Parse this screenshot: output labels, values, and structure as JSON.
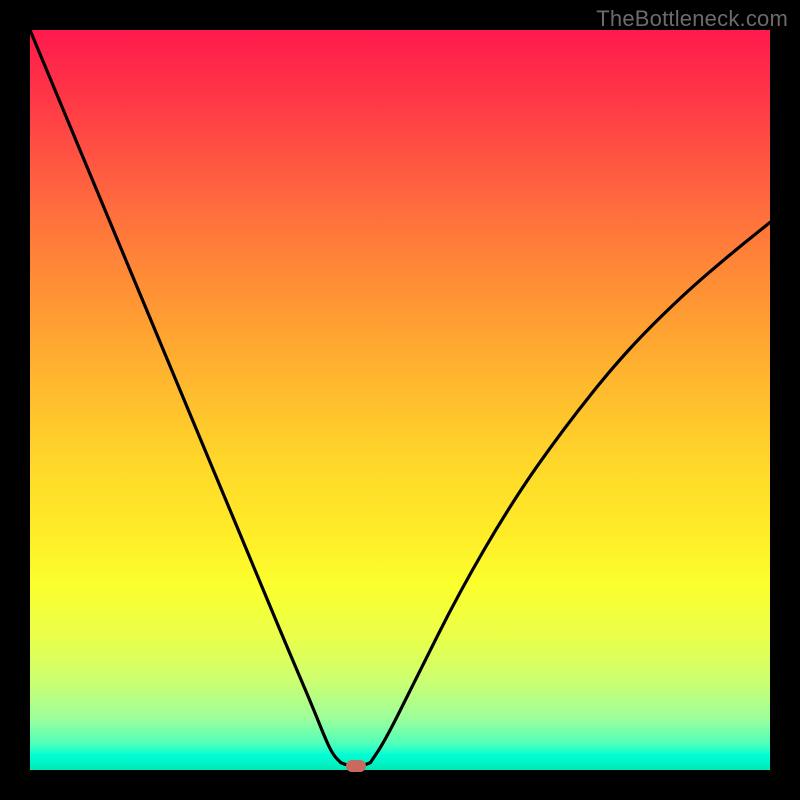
{
  "watermark": "TheBottleneck.com",
  "colors": {
    "frame": "#000000",
    "curve": "#000000",
    "marker": "#c96a5e",
    "gradient_top": "#ff1a4d",
    "gradient_bottom": "#00e8b6"
  },
  "chart_data": {
    "type": "line",
    "title": "",
    "xlabel": "",
    "ylabel": "",
    "xlim": [
      0,
      100
    ],
    "ylim": [
      0,
      100
    ],
    "grid": false,
    "legend": false,
    "series": [
      {
        "name": "left-branch",
        "x": [
          0,
          5,
          10,
          15,
          20,
          25,
          30,
          35,
          38,
          40,
          41,
          42
        ],
        "y": [
          100,
          88,
          76,
          64,
          52,
          40,
          28,
          16,
          9,
          4,
          2,
          1
        ]
      },
      {
        "name": "valley-floor",
        "x": [
          42,
          43,
          44,
          45,
          46
        ],
        "y": [
          1,
          0.6,
          0.5,
          0.6,
          1
        ]
      },
      {
        "name": "right-branch",
        "x": [
          46,
          48,
          52,
          58,
          65,
          72,
          80,
          88,
          95,
          100
        ],
        "y": [
          1,
          4,
          12,
          24,
          36,
          46,
          56,
          64,
          70,
          74
        ]
      }
    ],
    "annotations": [
      {
        "name": "minimum-marker",
        "x": 44,
        "y": 0.5
      }
    ]
  }
}
